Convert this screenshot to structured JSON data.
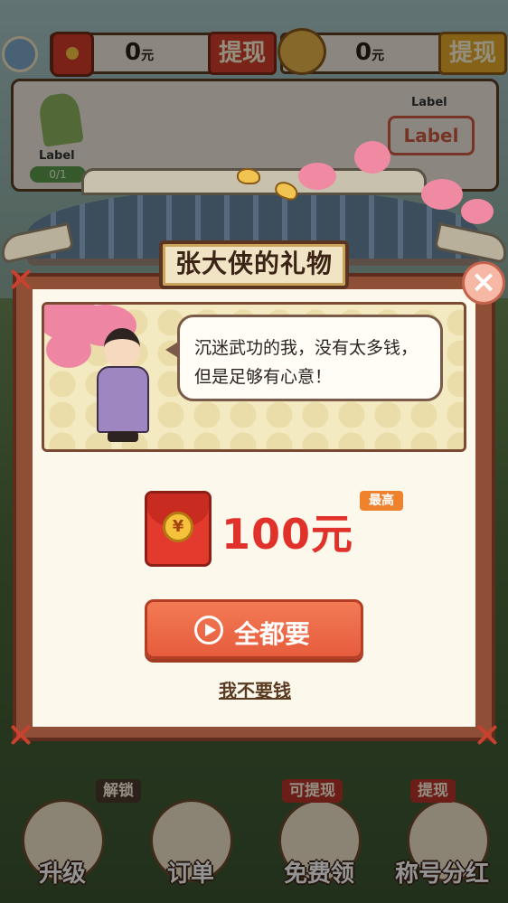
{
  "topbar": {
    "wallet_cash": {
      "amount": "0",
      "unit": "元",
      "withdraw_label": "提现"
    },
    "wallet_savings": {
      "amount": "0",
      "unit": "元",
      "withdraw_label": "提现"
    }
  },
  "task_card": {
    "left_label": "Label",
    "progress": "0/1",
    "right_label": "Label",
    "right_button": "Label"
  },
  "modal": {
    "title": "张大侠的礼物",
    "speech": "沉迷武功的我，没有太多钱，但是足够有心意！",
    "reward": {
      "coin_symbol": "¥",
      "amount": "100元",
      "max_tag": "最高"
    },
    "primary_button": "全都要",
    "decline_link": "我不要钱",
    "close_symbol": "×"
  },
  "bottom_nav": {
    "items": [
      {
        "label": "升级",
        "tag": "解锁"
      },
      {
        "label": "订单",
        "tag": ""
      },
      {
        "label": "免费领",
        "tag": "可提现"
      },
      {
        "label": "称号分红",
        "tag": "提现"
      }
    ]
  },
  "colors": {
    "accent_red": "#e0322a",
    "button_orange": "#e65d3d",
    "frame_brown": "#8f4e36",
    "panel_cream": "#fcf8ec"
  }
}
